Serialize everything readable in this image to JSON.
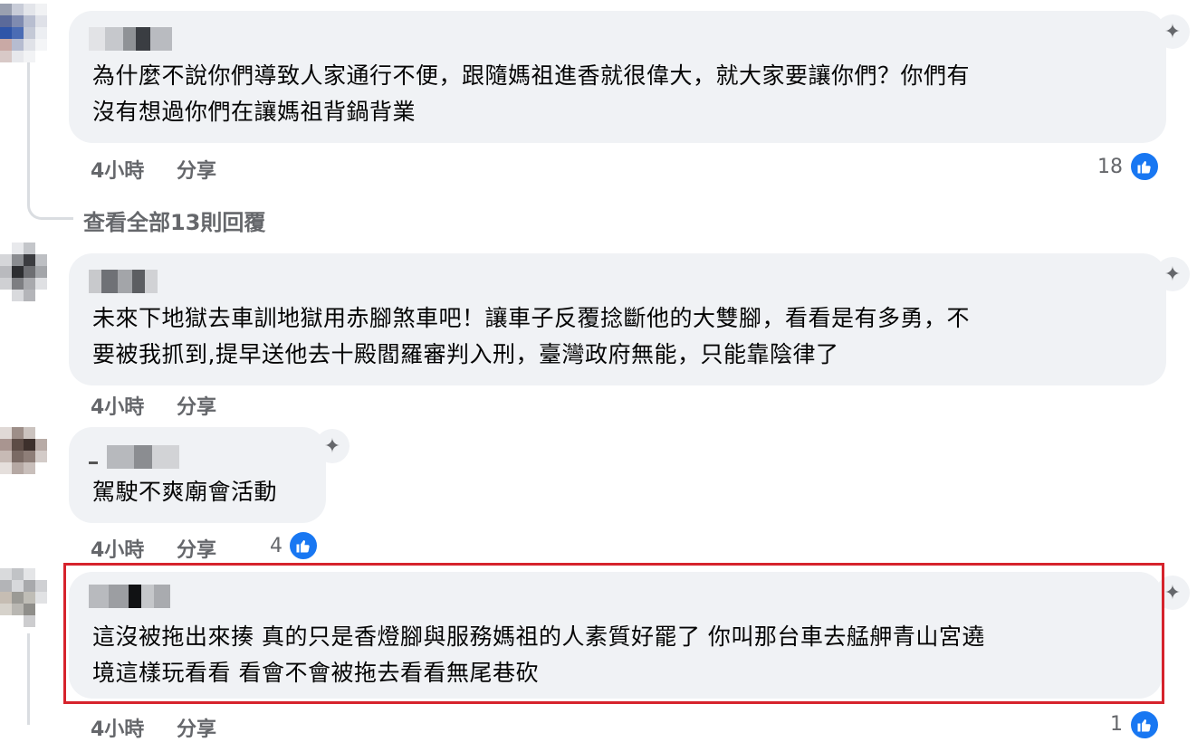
{
  "comments": [
    {
      "text_line1": "為什麼不說你們導致人家通行不便，跟隨媽祖進香就很偉大，就大家要讓你們？你們有",
      "text_line2": "沒有想過你們在讓媽祖背鍋背業",
      "time": "4小時",
      "share": "分享",
      "likes": "18"
    },
    {
      "text_line1": "未來下地獄去車訓地獄用赤腳煞車吧！讓車子反覆捻斷他的大雙腳，看看是有多勇，不",
      "text_line2": "要被我抓到,提早送他去十殿閻羅審判入刑，臺灣政府無能，只能靠陰律了",
      "time": "4小時",
      "share": "分享"
    },
    {
      "text_line1": "駕駛不爽廟會活動",
      "time": "4小時",
      "share": "分享",
      "likes": "4"
    },
    {
      "text_line1": "這沒被拖出來揍 真的只是香燈腳與服務媽祖的人素質好罷了 你叫那台車去艋舺青山宮遶",
      "text_line2": "境這樣玩看看 看會不會被拖去看看無尾巷砍",
      "time": "4小時",
      "share": "分享",
      "likes": "1"
    }
  ],
  "view_replies": "查看全部13則回覆",
  "icons": {
    "ai": "sparkle-icon",
    "like": "thumbs-up-icon"
  },
  "colors": {
    "like_blue": "#1877f2",
    "highlight_red": "#d6232c",
    "bubble": "#f0f2f5"
  }
}
